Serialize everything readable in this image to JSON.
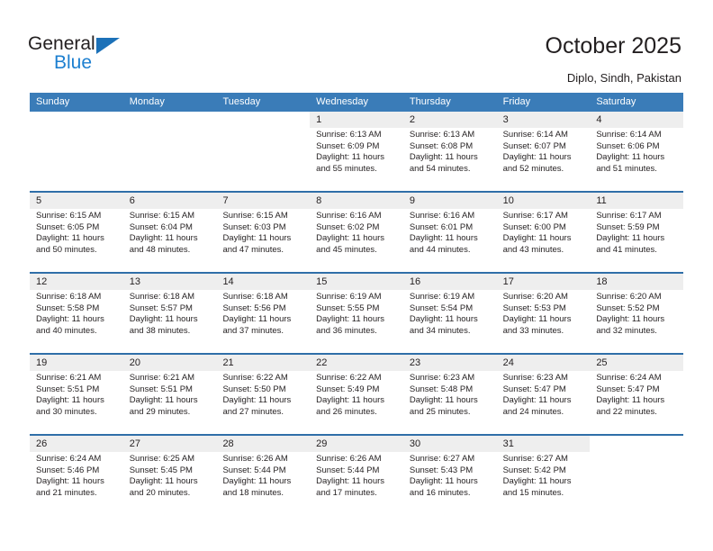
{
  "brand": {
    "name_top": "General",
    "name_bottom": "Blue",
    "accent_color": "#1c7fd0",
    "triangle_color": "#1c71b8"
  },
  "header": {
    "title": "October 2025",
    "subtitle": "Diplo, Sindh, Pakistan"
  },
  "calendar": {
    "header_color": "#3a7cb8",
    "date_band_color": "#eeeeee",
    "weekdays": [
      "Sunday",
      "Monday",
      "Tuesday",
      "Wednesday",
      "Thursday",
      "Friday",
      "Saturday"
    ],
    "weeks": [
      [
        {
          "day": "",
          "sunrise": "",
          "sunset": "",
          "daylight_line1": "",
          "daylight_line2": "",
          "empty": true
        },
        {
          "day": "",
          "sunrise": "",
          "sunset": "",
          "daylight_line1": "",
          "daylight_line2": "",
          "empty": true
        },
        {
          "day": "",
          "sunrise": "",
          "sunset": "",
          "daylight_line1": "",
          "daylight_line2": "",
          "empty": true
        },
        {
          "day": "1",
          "sunrise": "Sunrise: 6:13 AM",
          "sunset": "Sunset: 6:09 PM",
          "daylight_line1": "Daylight: 11 hours",
          "daylight_line2": "and 55 minutes."
        },
        {
          "day": "2",
          "sunrise": "Sunrise: 6:13 AM",
          "sunset": "Sunset: 6:08 PM",
          "daylight_line1": "Daylight: 11 hours",
          "daylight_line2": "and 54 minutes."
        },
        {
          "day": "3",
          "sunrise": "Sunrise: 6:14 AM",
          "sunset": "Sunset: 6:07 PM",
          "daylight_line1": "Daylight: 11 hours",
          "daylight_line2": "and 52 minutes."
        },
        {
          "day": "4",
          "sunrise": "Sunrise: 6:14 AM",
          "sunset": "Sunset: 6:06 PM",
          "daylight_line1": "Daylight: 11 hours",
          "daylight_line2": "and 51 minutes."
        }
      ],
      [
        {
          "day": "5",
          "sunrise": "Sunrise: 6:15 AM",
          "sunset": "Sunset: 6:05 PM",
          "daylight_line1": "Daylight: 11 hours",
          "daylight_line2": "and 50 minutes."
        },
        {
          "day": "6",
          "sunrise": "Sunrise: 6:15 AM",
          "sunset": "Sunset: 6:04 PM",
          "daylight_line1": "Daylight: 11 hours",
          "daylight_line2": "and 48 minutes."
        },
        {
          "day": "7",
          "sunrise": "Sunrise: 6:15 AM",
          "sunset": "Sunset: 6:03 PM",
          "daylight_line1": "Daylight: 11 hours",
          "daylight_line2": "and 47 minutes."
        },
        {
          "day": "8",
          "sunrise": "Sunrise: 6:16 AM",
          "sunset": "Sunset: 6:02 PM",
          "daylight_line1": "Daylight: 11 hours",
          "daylight_line2": "and 45 minutes."
        },
        {
          "day": "9",
          "sunrise": "Sunrise: 6:16 AM",
          "sunset": "Sunset: 6:01 PM",
          "daylight_line1": "Daylight: 11 hours",
          "daylight_line2": "and 44 minutes."
        },
        {
          "day": "10",
          "sunrise": "Sunrise: 6:17 AM",
          "sunset": "Sunset: 6:00 PM",
          "daylight_line1": "Daylight: 11 hours",
          "daylight_line2": "and 43 minutes."
        },
        {
          "day": "11",
          "sunrise": "Sunrise: 6:17 AM",
          "sunset": "Sunset: 5:59 PM",
          "daylight_line1": "Daylight: 11 hours",
          "daylight_line2": "and 41 minutes."
        }
      ],
      [
        {
          "day": "12",
          "sunrise": "Sunrise: 6:18 AM",
          "sunset": "Sunset: 5:58 PM",
          "daylight_line1": "Daylight: 11 hours",
          "daylight_line2": "and 40 minutes."
        },
        {
          "day": "13",
          "sunrise": "Sunrise: 6:18 AM",
          "sunset": "Sunset: 5:57 PM",
          "daylight_line1": "Daylight: 11 hours",
          "daylight_line2": "and 38 minutes."
        },
        {
          "day": "14",
          "sunrise": "Sunrise: 6:18 AM",
          "sunset": "Sunset: 5:56 PM",
          "daylight_line1": "Daylight: 11 hours",
          "daylight_line2": "and 37 minutes."
        },
        {
          "day": "15",
          "sunrise": "Sunrise: 6:19 AM",
          "sunset": "Sunset: 5:55 PM",
          "daylight_line1": "Daylight: 11 hours",
          "daylight_line2": "and 36 minutes."
        },
        {
          "day": "16",
          "sunrise": "Sunrise: 6:19 AM",
          "sunset": "Sunset: 5:54 PM",
          "daylight_line1": "Daylight: 11 hours",
          "daylight_line2": "and 34 minutes."
        },
        {
          "day": "17",
          "sunrise": "Sunrise: 6:20 AM",
          "sunset": "Sunset: 5:53 PM",
          "daylight_line1": "Daylight: 11 hours",
          "daylight_line2": "and 33 minutes."
        },
        {
          "day": "18",
          "sunrise": "Sunrise: 6:20 AM",
          "sunset": "Sunset: 5:52 PM",
          "daylight_line1": "Daylight: 11 hours",
          "daylight_line2": "and 32 minutes."
        }
      ],
      [
        {
          "day": "19",
          "sunrise": "Sunrise: 6:21 AM",
          "sunset": "Sunset: 5:51 PM",
          "daylight_line1": "Daylight: 11 hours",
          "daylight_line2": "and 30 minutes."
        },
        {
          "day": "20",
          "sunrise": "Sunrise: 6:21 AM",
          "sunset": "Sunset: 5:51 PM",
          "daylight_line1": "Daylight: 11 hours",
          "daylight_line2": "and 29 minutes."
        },
        {
          "day": "21",
          "sunrise": "Sunrise: 6:22 AM",
          "sunset": "Sunset: 5:50 PM",
          "daylight_line1": "Daylight: 11 hours",
          "daylight_line2": "and 27 minutes."
        },
        {
          "day": "22",
          "sunrise": "Sunrise: 6:22 AM",
          "sunset": "Sunset: 5:49 PM",
          "daylight_line1": "Daylight: 11 hours",
          "daylight_line2": "and 26 minutes."
        },
        {
          "day": "23",
          "sunrise": "Sunrise: 6:23 AM",
          "sunset": "Sunset: 5:48 PM",
          "daylight_line1": "Daylight: 11 hours",
          "daylight_line2": "and 25 minutes."
        },
        {
          "day": "24",
          "sunrise": "Sunrise: 6:23 AM",
          "sunset": "Sunset: 5:47 PM",
          "daylight_line1": "Daylight: 11 hours",
          "daylight_line2": "and 24 minutes."
        },
        {
          "day": "25",
          "sunrise": "Sunrise: 6:24 AM",
          "sunset": "Sunset: 5:47 PM",
          "daylight_line1": "Daylight: 11 hours",
          "daylight_line2": "and 22 minutes."
        }
      ],
      [
        {
          "day": "26",
          "sunrise": "Sunrise: 6:24 AM",
          "sunset": "Sunset: 5:46 PM",
          "daylight_line1": "Daylight: 11 hours",
          "daylight_line2": "and 21 minutes."
        },
        {
          "day": "27",
          "sunrise": "Sunrise: 6:25 AM",
          "sunset": "Sunset: 5:45 PM",
          "daylight_line1": "Daylight: 11 hours",
          "daylight_line2": "and 20 minutes."
        },
        {
          "day": "28",
          "sunrise": "Sunrise: 6:26 AM",
          "sunset": "Sunset: 5:44 PM",
          "daylight_line1": "Daylight: 11 hours",
          "daylight_line2": "and 18 minutes."
        },
        {
          "day": "29",
          "sunrise": "Sunrise: 6:26 AM",
          "sunset": "Sunset: 5:44 PM",
          "daylight_line1": "Daylight: 11 hours",
          "daylight_line2": "and 17 minutes."
        },
        {
          "day": "30",
          "sunrise": "Sunrise: 6:27 AM",
          "sunset": "Sunset: 5:43 PM",
          "daylight_line1": "Daylight: 11 hours",
          "daylight_line2": "and 16 minutes."
        },
        {
          "day": "31",
          "sunrise": "Sunrise: 6:27 AM",
          "sunset": "Sunset: 5:42 PM",
          "daylight_line1": "Daylight: 11 hours",
          "daylight_line2": "and 15 minutes."
        },
        {
          "day": "",
          "sunrise": "",
          "sunset": "",
          "daylight_line1": "",
          "daylight_line2": "",
          "empty": true
        }
      ]
    ]
  }
}
